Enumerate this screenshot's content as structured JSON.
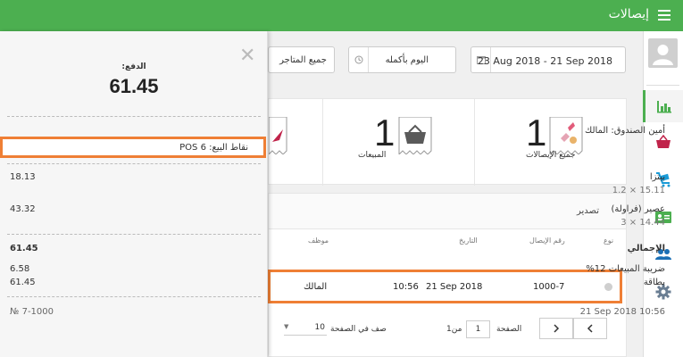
{
  "app": {
    "title": "إيصالات"
  },
  "filters": {
    "date_range": "23 Aug 2018 - 21 Sep 2018",
    "time": "اليوم بأكمله",
    "store": "جميع المتاجر"
  },
  "stats": {
    "receipts": {
      "count": "1",
      "label": "جميع الإيصالات"
    },
    "sales": {
      "count": "1",
      "label": "المبيعات"
    }
  },
  "table": {
    "export_label": "تصدير",
    "columns": [
      "نوع",
      "رقم الإيصال",
      "التاريخ",
      "موظف"
    ],
    "rows": [
      {
        "receipt_no": "1000-7",
        "date": "21 Sep 2018",
        "time": "10:56",
        "employee": "المالك"
      }
    ]
  },
  "pagination": {
    "page_label": "الصفحة",
    "page_value": "1",
    "of_label": "من1",
    "rows_label": "صف في الصفحة",
    "rows_value": "10"
  },
  "receipt": {
    "payment_label": "الدفع:",
    "total": "61.45",
    "cashier": "أمين الصندوق: المالك",
    "pos": "نقاط البيع: POS 6",
    "items": [
      {
        "name": "بيتزا",
        "qty_price": "1.2 × 15.11",
        "amount": "18.13"
      },
      {
        "name": "عصير (فراولة)",
        "qty_price": "3 × 14.44",
        "amount": "43.32"
      }
    ],
    "total_label": "الإجمالي",
    "total_value": "61.45",
    "tax_label": "ضريبة المبيعات 12%",
    "tax_value": "6.58",
    "card_label": "بطاقة",
    "card_value": "61.45",
    "footer_no": "№ 7-1000",
    "footer_date": "21 Sep 2018 10:56"
  },
  "colors": {
    "accent": "#4caf50",
    "highlight": "#ef7f35",
    "icon_red": "#c0234a",
    "icon_blue": "#1a9bd7"
  }
}
